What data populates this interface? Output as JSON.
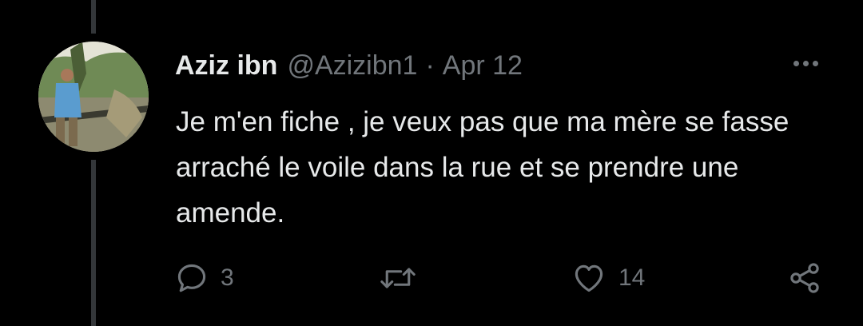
{
  "tweet": {
    "display_name": "Aziz ibn",
    "handle": "@Azizibn1",
    "separator": "·",
    "date": "Apr 12",
    "text": "Je m'en fiche , je veux pas que ma mère se fasse arraché le voile dans la rue et se prendre une amende.",
    "replies": "3",
    "likes": "14"
  },
  "icons": {
    "reply": "reply-icon",
    "retweet": "retweet-icon",
    "like": "heart-icon",
    "share": "share-icon",
    "more": "more-icon"
  },
  "colors": {
    "background": "#000000",
    "primary_text": "#e7e9ea",
    "secondary_text": "#71767b",
    "thread_line": "#333639"
  }
}
